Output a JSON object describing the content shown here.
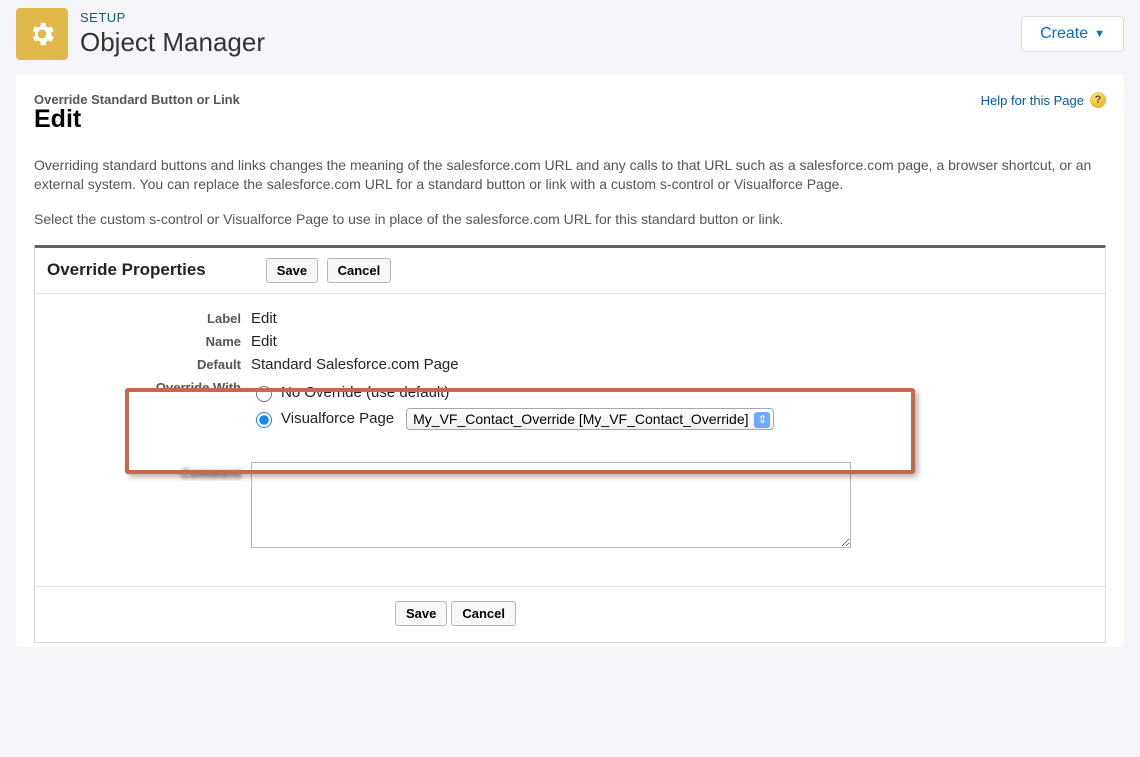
{
  "header": {
    "crumb": "SETUP",
    "title": "Object Manager",
    "create_label": "Create"
  },
  "card": {
    "eyebrow": "Override Standard Button or Link",
    "title": "Edit",
    "help_label": "Help for this Page"
  },
  "desc": {
    "p1": "Overriding standard buttons and links changes the meaning of the salesforce.com URL and any calls to that URL such as a salesforce.com page, a browser shortcut, or an external system. You can replace the salesforce.com URL for a standard button or link with a custom s-control or Visualforce Page.",
    "p2": "Select the custom s-control or Visualforce Page to use in place of the salesforce.com URL for this standard button or link."
  },
  "panel": {
    "title": "Override Properties",
    "save_label": "Save",
    "cancel_label": "Cancel"
  },
  "form": {
    "label_lbl": "Label",
    "label_val": "Edit",
    "name_lbl": "Name",
    "name_val": "Edit",
    "default_lbl": "Default",
    "default_val": "Standard Salesforce.com Page",
    "override_lbl": "Override With",
    "no_override": "No Override (use default)",
    "vf_page": "Visualforce Page",
    "vf_selected": "My_VF_Contact_Override [My_VF_Contact_Override]",
    "comment_lbl": "Comment",
    "comment_val": ""
  },
  "footer": {
    "save_label": "Save",
    "cancel_label": "Cancel"
  }
}
